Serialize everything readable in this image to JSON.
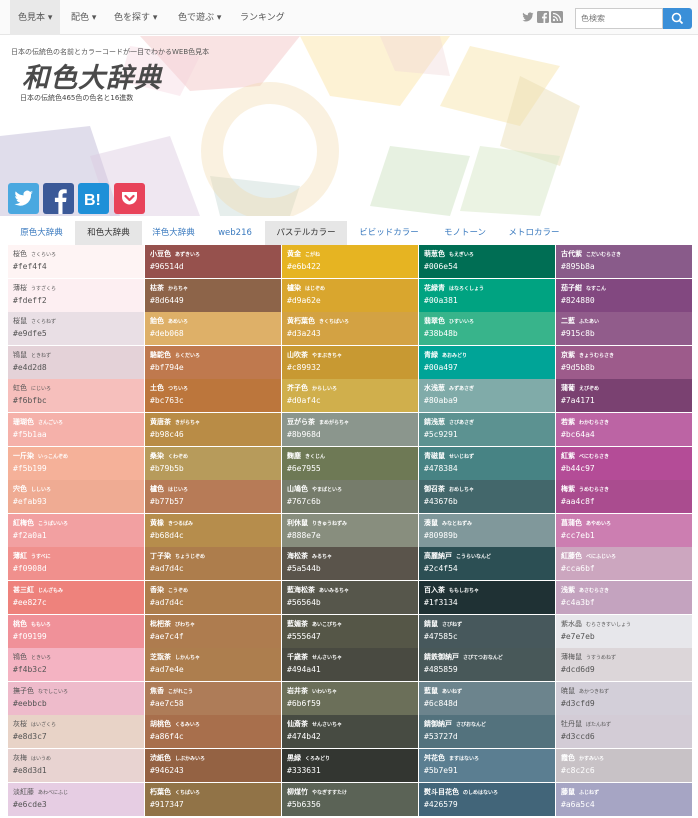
{
  "nav": {
    "items": [
      "色見本",
      "配色",
      "色を探す",
      "色で遊ぶ",
      "ランキング"
    ],
    "search_placeholder": "色検索"
  },
  "header": {
    "tagline": "日本の伝統色の名前とカラーコードが一目でわかるWEB色見本",
    "logo": "和色大辞典",
    "subtitle": "日本の伝統色465色の色名と16進数"
  },
  "share_icons": [
    "twitter-icon",
    "facebook-icon",
    "hatena-bookmark-icon",
    "pocket-icon"
  ],
  "share_colors": [
    "#4aa8e0",
    "#3b5998",
    "#1e90d8",
    "#e8435a"
  ],
  "tabs": [
    "原色大辞典",
    "和色大辞典",
    "洋色大辞典",
    "web216",
    "パステルカラー",
    "ビビッドカラー",
    "モノトーン",
    "メトロカラー"
  ],
  "columns": [
    [
      {
        "name": "桜色",
        "reading": "さくらいろ",
        "hex": "#fef4f4"
      },
      {
        "name": "薄桜",
        "reading": "うすざくら",
        "hex": "#fdeff2"
      },
      {
        "name": "桜鼠",
        "reading": "さくらねず",
        "hex": "#e9dfe5"
      },
      {
        "name": "鴇鼠",
        "reading": "ときねず",
        "hex": "#e4d2d8"
      },
      {
        "name": "虹色",
        "reading": "にじいろ",
        "hex": "#f6bfbc"
      },
      {
        "name": "珊瑚色",
        "reading": "さんごいろ",
        "hex": "#f5b1aa"
      },
      {
        "name": "一斤染",
        "reading": "いっこんぞめ",
        "hex": "#f5b199"
      },
      {
        "name": "宍色",
        "reading": "ししいろ",
        "hex": "#efab93"
      },
      {
        "name": "紅梅色",
        "reading": "こうばいいろ",
        "hex": "#f2a0a1"
      },
      {
        "name": "薄紅",
        "reading": "うすべに",
        "hex": "#f0908d"
      },
      {
        "name": "甚三紅",
        "reading": "じんざもみ",
        "hex": "#ee827c"
      },
      {
        "name": "桃色",
        "reading": "ももいろ",
        "hex": "#f09199"
      },
      {
        "name": "鴇色",
        "reading": "ときいろ",
        "hex": "#f4b3c2"
      },
      {
        "name": "撫子色",
        "reading": "なでしこいろ",
        "hex": "#eebbcb"
      },
      {
        "name": "灰桜",
        "reading": "はいざくら",
        "hex": "#e8d3c7"
      },
      {
        "name": "灰梅",
        "reading": "はいうめ",
        "hex": "#e8d3d1"
      },
      {
        "name": "淡紅藤",
        "reading": "あわべにふじ",
        "hex": "#e6cde3"
      }
    ],
    [
      {
        "name": "小豆色",
        "reading": "あずきいろ",
        "hex": "#96514d"
      },
      {
        "name": "枯茶",
        "reading": "からちゃ",
        "hex": "#8d6449"
      },
      {
        "name": "飴色",
        "reading": "あめいろ",
        "hex": "#deb068"
      },
      {
        "name": "駱駝色",
        "reading": "らくだいろ",
        "hex": "#bf794e"
      },
      {
        "name": "土色",
        "reading": "つちいろ",
        "hex": "#bc763c"
      },
      {
        "name": "黄唐茶",
        "reading": "きがらちゃ",
        "hex": "#b98c46"
      },
      {
        "name": "桑染",
        "reading": "くわぞめ",
        "hex": "#b79b5b"
      },
      {
        "name": "櫨色",
        "reading": "はじいろ",
        "hex": "#b77b57"
      },
      {
        "name": "黄橡",
        "reading": "きつるばみ",
        "hex": "#b68d4c"
      },
      {
        "name": "丁子染",
        "reading": "ちょうじぞめ",
        "hex": "#ad7d4c"
      },
      {
        "name": "香染",
        "reading": "こうぞめ",
        "hex": "#ad7d4c"
      },
      {
        "name": "枇杷茶",
        "reading": "びわちゃ",
        "hex": "#ae7c4f"
      },
      {
        "name": "芝翫茶",
        "reading": "しかんちゃ",
        "hex": "#ad7e4e"
      },
      {
        "name": "焦香",
        "reading": "こがれこう",
        "hex": "#ae7c58"
      },
      {
        "name": "胡桃色",
        "reading": "くるみいろ",
        "hex": "#a86f4c"
      },
      {
        "name": "渋紙色",
        "reading": "しぶかみいろ",
        "hex": "#946243"
      },
      {
        "name": "朽葉色",
        "reading": "くちばいろ",
        "hex": "#917347"
      }
    ],
    [
      {
        "name": "黄金",
        "reading": "こがね",
        "hex": "#e6b422"
      },
      {
        "name": "櫨染",
        "reading": "はじぞめ",
        "hex": "#d9a62e"
      },
      {
        "name": "黄朽葉色",
        "reading": "きくちばいろ",
        "hex": "#d3a243"
      },
      {
        "name": "山吹茶",
        "reading": "やまぶきちゃ",
        "hex": "#c89932"
      },
      {
        "name": "芥子色",
        "reading": "からしいろ",
        "hex": "#d0af4c"
      },
      {
        "name": "豆がら茶",
        "reading": "まめがらちゃ",
        "hex": "#8b968d"
      },
      {
        "name": "麴塵",
        "reading": "きくじん",
        "hex": "#6e7955"
      },
      {
        "name": "山鳩色",
        "reading": "やまばといろ",
        "hex": "#767c6b"
      },
      {
        "name": "利休鼠",
        "reading": "りきゅうねずみ",
        "hex": "#888e7e"
      },
      {
        "name": "海松茶",
        "reading": "みるちゃ",
        "hex": "#5a544b"
      },
      {
        "name": "藍海松茶",
        "reading": "あいみるちゃ",
        "hex": "#56564b"
      },
      {
        "name": "藍媚茶",
        "reading": "あいこびちゃ",
        "hex": "#555647"
      },
      {
        "name": "千歳茶",
        "reading": "せんさいちゃ",
        "hex": "#494a41"
      },
      {
        "name": "岩井茶",
        "reading": "いわいちゃ",
        "hex": "#6b6f59"
      },
      {
        "name": "仙斎茶",
        "reading": "せんさいちゃ",
        "hex": "#474b42"
      },
      {
        "name": "黒緑",
        "reading": "くろみどり",
        "hex": "#333631"
      },
      {
        "name": "柳煤竹",
        "reading": "やなぎすすたけ",
        "hex": "#5b6356"
      }
    ],
    [
      {
        "name": "萌葱色",
        "reading": "もえぎいろ",
        "hex": "#006e54"
      },
      {
        "name": "花緑青",
        "reading": "はなろくしょう",
        "hex": "#00a381"
      },
      {
        "name": "翡翠色",
        "reading": "ひすいいろ",
        "hex": "#38b48b"
      },
      {
        "name": "青緑",
        "reading": "あおみどり",
        "hex": "#00a497"
      },
      {
        "name": "水浅葱",
        "reading": "みずあさぎ",
        "hex": "#80aba9"
      },
      {
        "name": "錆浅葱",
        "reading": "さびあさぎ",
        "hex": "#5c9291"
      },
      {
        "name": "青磁鼠",
        "reading": "せいじねず",
        "hex": "#478384"
      },
      {
        "name": "御召茶",
        "reading": "おめしちゃ",
        "hex": "#43676b"
      },
      {
        "name": "湊鼠",
        "reading": "みなとねずみ",
        "hex": "#80989b"
      },
      {
        "name": "高麗納戸",
        "reading": "こうらいなんど",
        "hex": "#2c4f54"
      },
      {
        "name": "百入茶",
        "reading": "ももしおちゃ",
        "hex": "#1f3134"
      },
      {
        "name": "錆鼠",
        "reading": "さびねず",
        "hex": "#47585c"
      },
      {
        "name": "錆鉄御納戸",
        "reading": "さびてつおなんど",
        "hex": "#485859"
      },
      {
        "name": "藍鼠",
        "reading": "あいねず",
        "hex": "#6c848d"
      },
      {
        "name": "錆御納戸",
        "reading": "さびおなんど",
        "hex": "#53727d"
      },
      {
        "name": "舛花色",
        "reading": "ますはないろ",
        "hex": "#5b7e91"
      },
      {
        "name": "熨斗目花色",
        "reading": "のしめはないろ",
        "hex": "#426579"
      }
    ],
    [
      {
        "name": "古代紫",
        "reading": "こだいむらさき",
        "hex": "#895b8a"
      },
      {
        "name": "茄子紺",
        "reading": "なすこん",
        "hex": "#824880"
      },
      {
        "name": "二藍",
        "reading": "ふたあい",
        "hex": "#915c8b"
      },
      {
        "name": "京紫",
        "reading": "きょうむらさき",
        "hex": "#9d5b8b"
      },
      {
        "name": "蒲葡",
        "reading": "えびぞめ",
        "hex": "#7a4171"
      },
      {
        "name": "若紫",
        "reading": "わかむらさき",
        "hex": "#bc64a4"
      },
      {
        "name": "紅紫",
        "reading": "べにむらさき",
        "hex": "#b44c97"
      },
      {
        "name": "梅紫",
        "reading": "うめむらさき",
        "hex": "#aa4c8f"
      },
      {
        "name": "菖蒲色",
        "reading": "あやめいろ",
        "hex": "#cc7eb1"
      },
      {
        "name": "紅藤色",
        "reading": "べにふじいろ",
        "hex": "#cca6bf"
      },
      {
        "name": "浅紫",
        "reading": "あさむらさき",
        "hex": "#c4a3bf"
      },
      {
        "name": "紫水晶",
        "reading": "むらさきすいしょう",
        "hex": "#e7e7eb"
      },
      {
        "name": "薄梅鼠",
        "reading": "うすうめねず",
        "hex": "#dcd6d9"
      },
      {
        "name": "暁鼠",
        "reading": "あかつきねず",
        "hex": "#d3cfd9"
      },
      {
        "name": "牡丹鼠",
        "reading": "ぼたんねず",
        "hex": "#d3ccd6"
      },
      {
        "name": "霞色",
        "reading": "かすみいろ",
        "hex": "#c8c2c6"
      },
      {
        "name": "藤鼠",
        "reading": "ふじねず",
        "hex": "#a6a5c4"
      }
    ]
  ]
}
